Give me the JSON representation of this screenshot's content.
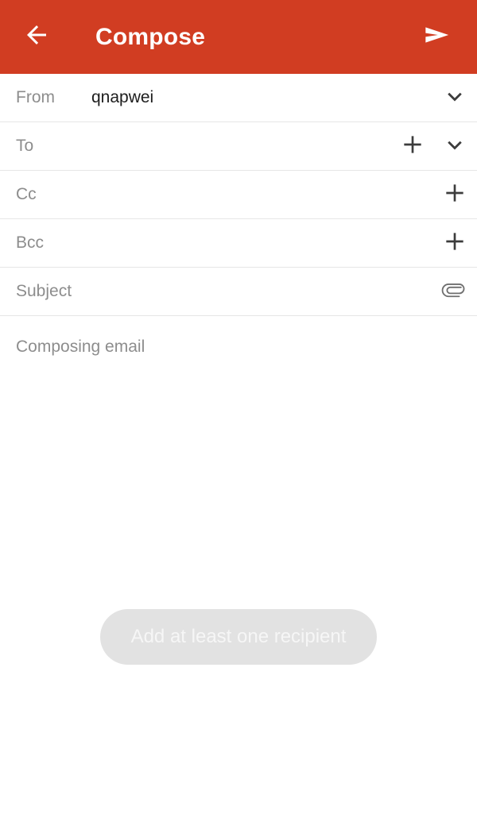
{
  "appbar": {
    "back_icon": "arrow-left-icon",
    "title": "Compose",
    "send_icon": "send-icon",
    "background_color": "#d13d22",
    "foreground_color": "#ffffff"
  },
  "fields": [
    {
      "label": "From",
      "value": "qnapwei",
      "has_add": false,
      "has_expand": true,
      "has_attach": false
    },
    {
      "label": "To",
      "value": "",
      "has_add": true,
      "has_expand": true,
      "has_attach": false
    },
    {
      "label": "Cc",
      "value": "",
      "has_add": true,
      "has_expand": false,
      "has_attach": false
    },
    {
      "label": "Bcc",
      "value": "",
      "has_add": true,
      "has_expand": false,
      "has_attach": false
    },
    {
      "label": "Subject",
      "value": "",
      "has_add": false,
      "has_expand": false,
      "has_attach": true
    }
  ],
  "body": {
    "placeholder": "Composing email",
    "value": ""
  },
  "toast": {
    "message": "Add at least one recipient",
    "background_color": "#e2e2e2",
    "text_color": "#f6f6f6"
  },
  "icons": {
    "add": "plus-icon",
    "expand": "chevron-down-icon",
    "attach": "paperclip-icon"
  },
  "colors": {
    "accent": "#d13d22",
    "label_gray": "#8d8d8d",
    "value_dark": "#1d1d1d",
    "divider": "#e6e6e6",
    "icon_gray": "#4a4a4a"
  }
}
